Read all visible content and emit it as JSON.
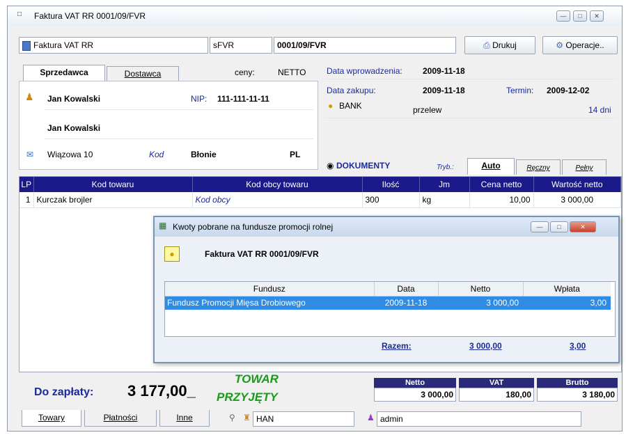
{
  "window": {
    "title": "Faktura VAT RR 0001/09/FVR"
  },
  "toolbar": {
    "doc_type": "Faktura VAT RR",
    "series": "sFVR",
    "number": "0001/09/FVR",
    "print_label": "Drukuj",
    "operations_label": "Operacje.."
  },
  "party_tabs": {
    "seller": "Sprzedawca",
    "supplier": "Dostawca"
  },
  "prices": {
    "label": "ceny:",
    "value": "NETTO"
  },
  "party": {
    "name": "Jan Kowalski",
    "nip_label": "NIP:",
    "nip": "111-111-11-11",
    "name2": "Jan Kowalski",
    "street": "Wiązowa 10",
    "postcode": "Kod",
    "city": "Błonie",
    "country": "PL"
  },
  "dates": {
    "entry_label": "Data wprowadzenia:",
    "entry": "2009-11-18",
    "purchase_label": "Data zakupu:",
    "purchase": "2009-11-18",
    "due_label": "Termin:",
    "due": "2009-12-02",
    "payment_form": "BANK",
    "payment_method": "przelew",
    "days": "14 dni"
  },
  "documents": {
    "title": "DOKUMENTY",
    "mode_label": "Tryb.:",
    "tabs": [
      "Auto",
      "Ręczny",
      "Pełny"
    ]
  },
  "grid": {
    "headers": [
      "LP",
      "Kod towaru",
      "Kod obcy towaru",
      "Ilość",
      "Jm",
      "Cena netto",
      "Wartość netto"
    ],
    "rows": [
      {
        "lp": "1",
        "code": "Kurczak brojler",
        "foreign": "Kod obcy",
        "qty": "300",
        "unit": "kg",
        "price": "10,00",
        "value": "3 000,00"
      }
    ]
  },
  "dialog": {
    "title": "Kwoty pobrane na fundusze promocji rolnej",
    "subtitle": "Faktura VAT RR 0001/09/FVR",
    "headers": [
      "Fundusz",
      "Data",
      "Netto",
      "Wpłata"
    ],
    "rows": [
      {
        "fund": "Fundusz Promocji Mięsa Drobiowego",
        "date": "2009-11-18",
        "net": "3 000,00",
        "paid": "3,00"
      }
    ],
    "total_label": "Razem:",
    "total_net": "3 000,00",
    "total_paid": "3,00"
  },
  "summary": {
    "to_pay_label": "Do zapłaty:",
    "to_pay": "3 177,00_",
    "status_line1": "TOWAR",
    "status_line2": "PRZYJĘTY",
    "netto_label": "Netto",
    "netto": "3 000,00",
    "vat_label": "VAT",
    "vat": "180,00",
    "brutto_label": "Brutto",
    "brutto": "3 180,00"
  },
  "bottom_tabs": [
    "Towary",
    "Płatności",
    "Inne"
  ],
  "status": {
    "warehouse": "HAN",
    "user": "admin"
  },
  "colors": {
    "header_blue": "#1a1a8a",
    "selection": "#2f8be4",
    "status_green": "#1a9a1a",
    "link_blue": "#1a2a9a"
  }
}
